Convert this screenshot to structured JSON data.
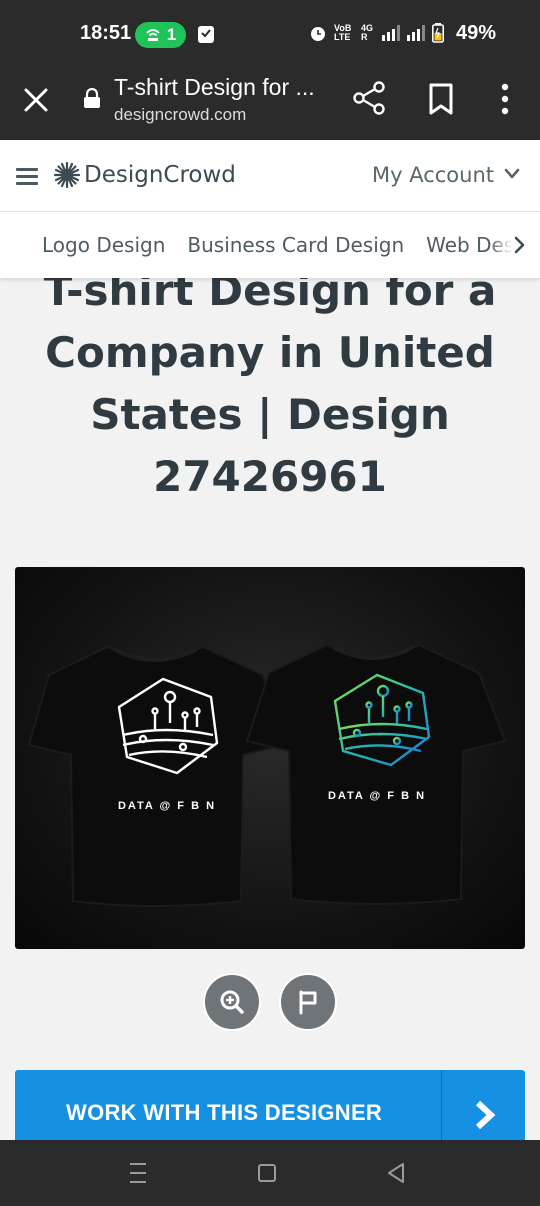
{
  "status_bar": {
    "time": "18:51",
    "hotspot_count": "1",
    "network_label_1": "VoB LTE",
    "network_label_2": "4G R",
    "battery": "49%"
  },
  "browser": {
    "page_title": "T-shirt Design for ...",
    "url": "designcrowd.com",
    "icons": [
      "close-icon",
      "lock-icon",
      "share-icon",
      "bookmark-icon",
      "more-vert-icon"
    ]
  },
  "site_header": {
    "logo_text": "DesignCrowd",
    "account_label": "My Account"
  },
  "category_nav": {
    "items": [
      "Logo Design",
      "Business Card Design",
      "Web Design"
    ]
  },
  "main": {
    "title": "T-shirt Design for a Company in United States | Design 27426961",
    "image": {
      "left_shirt_brand": "DATA @ F B N",
      "right_shirt_brand": "DATA @ F B N",
      "right_gradient_colors": [
        "#8be04a",
        "#24b9b0",
        "#1f7fd6"
      ]
    },
    "cta_label": "WORK WITH THIS DESIGNER"
  },
  "colors": {
    "cta_blue": "#1590e2",
    "title_text": "#2f3a41",
    "chrome_dark": "#2b2b2b",
    "hotspot_green": "#1fc35a"
  }
}
